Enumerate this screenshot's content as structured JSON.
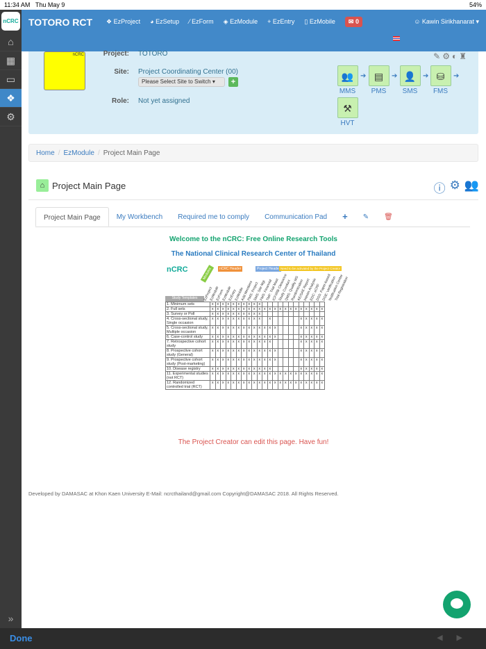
{
  "status": {
    "time": "11:34 AM",
    "date": "Thu May 9",
    "battery": "54%"
  },
  "sidebar": {
    "logo": "nCRC",
    "items": [
      {
        "icon": "home-icon",
        "glyph": "⌂"
      },
      {
        "icon": "grid-icon",
        "glyph": "▦"
      },
      {
        "icon": "archive-icon",
        "glyph": "▭"
      },
      {
        "icon": "cubes-icon",
        "glyph": "❖"
      },
      {
        "icon": "gear-icon",
        "glyph": "⚙"
      }
    ],
    "expand": "»"
  },
  "navbar": {
    "brand": "TOTORO RCT",
    "menu": [
      {
        "icon": "cubes-icon",
        "glyph": "❖",
        "label": "EzProject"
      },
      {
        "icon": "dashboard-icon",
        "glyph": "◕",
        "label": "EzSetup"
      },
      {
        "icon": "magic-icon",
        "glyph": "⁄",
        "label": "EzForm"
      },
      {
        "icon": "cube-icon",
        "glyph": "◈",
        "label": "EzModule"
      },
      {
        "icon": "plus-icon",
        "glyph": "+",
        "label": "EzEntry"
      },
      {
        "icon": "mobile-icon",
        "glyph": "▯",
        "label": "EzMobile"
      }
    ],
    "mail_count": "0",
    "user": "Kawin Sirikhanarat"
  },
  "project": {
    "logo_text": "nCRC",
    "project_label": "Project:",
    "project": "TOTORO",
    "site_label": "Site:",
    "site": "Project Coordinating Center (00)",
    "site_select": "Please Select Site to Switch",
    "role_label": "Role:",
    "role": "Not yet assigned",
    "modules": [
      {
        "label": "MMS",
        "glyph": "👥"
      },
      {
        "label": "PMS",
        "glyph": "▤"
      },
      {
        "label": "SMS",
        "glyph": "👤"
      },
      {
        "label": "FMS",
        "glyph": "⛁"
      },
      {
        "label": "HVT",
        "glyph": "⚒"
      }
    ]
  },
  "breadcrumb": [
    "Home",
    "EzModule",
    "Project Main Page"
  ],
  "page": {
    "title": "Project Main Page"
  },
  "tabs": [
    "Project Main Page",
    "My Workbench",
    "Required me to comply",
    "Communication Pad"
  ],
  "content": {
    "welcome": "Welcome to the nCRC: Free Online Research Tools",
    "center": "The National Clinical Research Center of Thailand",
    "footer_note": "The Project Creator can edit this page. Have fun!",
    "matrix": {
      "modules_label": "Modules",
      "groups": [
        "nCRC Header",
        "Project Header",
        "Need to be activated by the Project Creator"
      ],
      "templates_label": "Study Templates",
      "columns": [
        "EzProject",
        "EzModule",
        "EzForm",
        "EzModule",
        "EzEntry",
        "EzMobile",
        "Add Members",
        "PMS: Project",
        "SMS: Site Mgt",
        "FMS: Financial",
        "TMF: Trial Mast",
        "ICF/IRB Clearance",
        "Study Conduct",
        "QMS: Quality MS",
        "Randomization",
        "AE/SAE Report",
        "Interim Analysis",
        "EDC: eCRF",
        "DSS: Paper-based",
        "DOE: Verification",
        "Notification Center",
        "Trial Registration"
      ],
      "rows": [
        {
          "name": "1. Minimum sets",
          "x": "1111111111000000000000"
        },
        {
          "name": "2. Full sets",
          "x": "1111111111111111111111"
        },
        {
          "name": "3. Survey or Poll",
          "x": "1111111111000000000000"
        },
        {
          "name": "4. Cross-sectional study, Single occasion",
          "x": "1111111111010000011111"
        },
        {
          "name": "5. Cross-sectional study, Multiple occasion",
          "x": "1111111111111000011111"
        },
        {
          "name": "6. Case-control study",
          "x": "1111111111111000011111"
        },
        {
          "name": "7. Retrospective cohort study",
          "x": "1111111111110000011111"
        },
        {
          "name": "8. Prospective cohort study (General)",
          "x": "1111111111111000011111"
        },
        {
          "name": "9. Prospective cohort study (Post-marketing)",
          "x": "1111111111111000011111"
        },
        {
          "name": "10. Disease registry",
          "x": "1111111111110000011111"
        },
        {
          "name": "11. Experimental studies (not RCT)",
          "x": "1111111111111111111111"
        },
        {
          "name": "12. Randomized controlled trial (RCT)",
          "x": "1111111111111111111111"
        }
      ]
    }
  },
  "footer": "Developed by DAMASAC at Khon Kaen University E-Mail: ncrcthailand@gmail.com Copyright@DAMASAC 2018. All Rights Reserved.",
  "bottom": {
    "done": "Done"
  }
}
